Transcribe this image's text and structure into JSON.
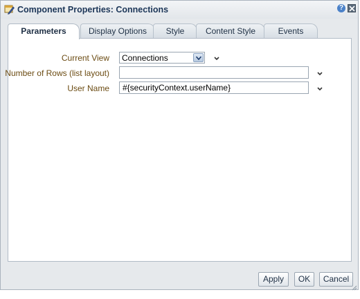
{
  "dialog": {
    "title": "Component Properties: Connections",
    "help_glyph": "?"
  },
  "tabs": [
    {
      "label": "Parameters",
      "active": true
    },
    {
      "label": "Display Options",
      "active": false
    },
    {
      "label": "Style",
      "active": false
    },
    {
      "label": "Content Style",
      "active": false
    },
    {
      "label": "Events",
      "active": false
    }
  ],
  "fields": {
    "current_view": {
      "label": "Current View",
      "value": "Connections"
    },
    "rows": {
      "label": "Number of Rows (list layout)",
      "value": ""
    },
    "user_name": {
      "label": "User Name",
      "value": "#{securityContext.userName}"
    }
  },
  "buttons": {
    "apply": "Apply",
    "ok": "OK",
    "cancel": "Cancel"
  },
  "colors": {
    "label_text": "#6b4b12",
    "title_text": "#1c3658",
    "accent": "#4b82c9"
  }
}
